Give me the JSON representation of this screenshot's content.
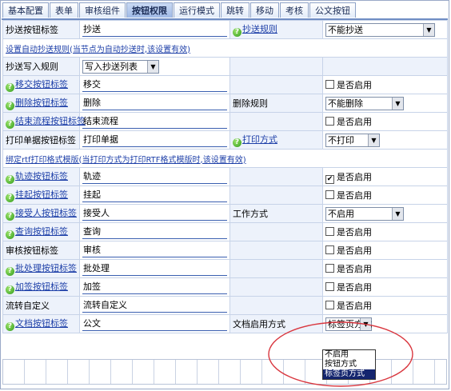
{
  "tabs": [
    "基本配置",
    "表单",
    "审核组件",
    "按钮权限",
    "运行模式",
    "跳转",
    "移动",
    "考核",
    "公文按钮"
  ],
  "active_tab": "按钮权限",
  "colors": {
    "tab_border": "#8ea3c8",
    "label_bg": "#edf2fb",
    "link": "#1d3fa8",
    "annotation": "#d9373f",
    "highlight": "#14256e"
  },
  "rows": {
    "cc_label": {
      "label": "抄送按钮标签",
      "value": "抄送",
      "rule_label": "抄送规则",
      "rule_value": "不能抄送"
    },
    "cc_note": "设置自动抄送规则(当节点为自动抄送时,该设置有效)",
    "cc_write": {
      "label": "抄送写入规则",
      "value": "写入抄送列表"
    },
    "transfer": {
      "label": "移交按钮标签",
      "value": "移交",
      "enable": "是否启用"
    },
    "delete": {
      "label": "删除按钮标签",
      "value": "删除",
      "rule_label": "删除规则",
      "rule_value": "不能删除"
    },
    "end": {
      "label": "结束流程按钮标签",
      "value": "结束流程",
      "enable": "是否启用"
    },
    "print": {
      "label": "打印单据按钮标签",
      "value": "打印单据",
      "mode_label": "打印方式",
      "mode_value": "不打印"
    },
    "print_note": "绑定rtf打印格式模版(当打印方式为打印RTF格式模版时,该设置有效)",
    "track": {
      "label": "轨迹按钮标签",
      "value": "轨迹",
      "enable": "是否启用",
      "checked": true
    },
    "hold": {
      "label": "挂起按钮标签",
      "value": "挂起",
      "enable": "是否启用"
    },
    "accept": {
      "label": "接受人按钮标签",
      "value": "接受人",
      "work_label": "工作方式",
      "work_value": "不启用"
    },
    "query": {
      "label": "查询按钮标签",
      "value": "查询",
      "enable": "是否启用"
    },
    "audit": {
      "label": "审核按钮标签",
      "value": "审核",
      "enable": "是否启用"
    },
    "batch": {
      "label": "批处理按钮标签",
      "value": "批处理",
      "enable": "是否启用"
    },
    "countersign": {
      "label": "加签按钮标签",
      "value": "加签",
      "enable": "是否启用"
    },
    "custom": {
      "label": "流转自定义",
      "value": "流转自定义",
      "enable": "是否启用"
    },
    "doc": {
      "label": "文档按钮标签",
      "value": "公文",
      "mode_label": "文档启用方式",
      "mode_value": "标签页方式"
    }
  },
  "dropdown_options": [
    "不启用",
    "按钮方式",
    "标签页方式"
  ],
  "dropdown_selected": "标签页方式"
}
